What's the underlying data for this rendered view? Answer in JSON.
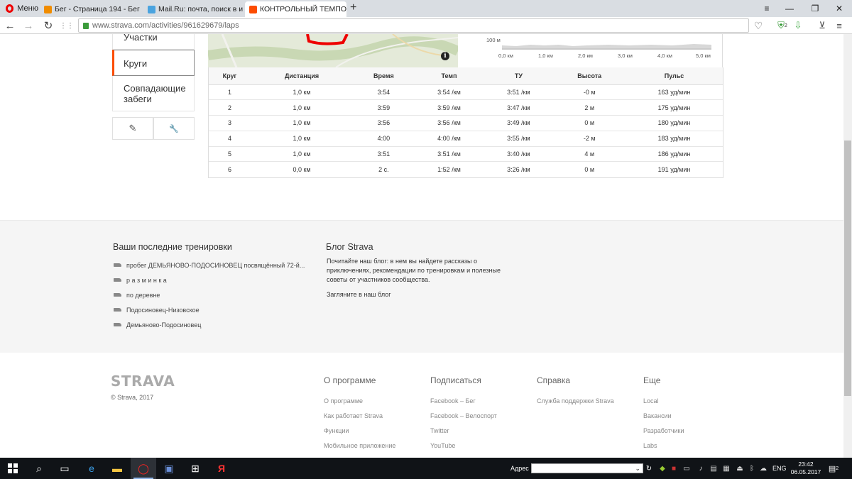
{
  "browser": {
    "menu_label": "Меню",
    "tabs": [
      {
        "title": "Бег - Страница 194 - Бег",
        "favicon_color": "#f08c00"
      },
      {
        "title": "Mail.Ru: почта, поиск в и",
        "favicon_color": "#4aa3df"
      },
      {
        "title": "КОНТРОЛЬНЫЙ ТЕМПОВ",
        "favicon_color": "#fc4c02"
      }
    ],
    "tab_close": "×",
    "new_tab": "+",
    "url": "www.strava.com/activities/961629679/laps",
    "icons": {
      "back": "←",
      "forward": "→",
      "reload": "↻",
      "speed_dial": "⋮⋮",
      "heart": "♡",
      "minimize": "—",
      "maximize": "❐",
      "close": "✕",
      "stash": "≡"
    },
    "ext_badge": "2"
  },
  "sidebar": {
    "items": [
      {
        "label": "Участки",
        "active": false
      },
      {
        "label": "Круги",
        "active": true
      },
      {
        "label": "Совпадающие забеги",
        "active": false
      }
    ],
    "tool_icons": {
      "edit": "✎",
      "settings": "🔧"
    }
  },
  "map": {
    "info_label": "i"
  },
  "elevation": {
    "y_label": "100 м",
    "x_labels": [
      "0,0 км",
      "1,0 км",
      "2,0 км",
      "3,0 км",
      "4,0 км",
      "5,0 км"
    ]
  },
  "laps": {
    "headers": [
      "Круг",
      "Дистанция",
      "Время",
      "Темп",
      "ТУ",
      "Высота",
      "Пульс"
    ],
    "rows": [
      [
        "1",
        "1,0 км",
        "3:54",
        "3:54 /км",
        "3:51 /км",
        "-0 м",
        "163 уд/мин"
      ],
      [
        "2",
        "1,0 км",
        "3:59",
        "3:59 /км",
        "3:47 /км",
        "2 м",
        "175 уд/мин"
      ],
      [
        "3",
        "1,0 км",
        "3:56",
        "3:56 /км",
        "3:49 /км",
        "0 м",
        "180 уд/мин"
      ],
      [
        "4",
        "1,0 км",
        "4:00",
        "4:00 /км",
        "3:55 /км",
        "-2 м",
        "183 уд/мин"
      ],
      [
        "5",
        "1,0 км",
        "3:51",
        "3:51 /км",
        "3:40 /км",
        "4 м",
        "186 уд/мин"
      ],
      [
        "6",
        "0,0 км",
        "2 с.",
        "1:52 /км",
        "3:26 /км",
        "0 м",
        "191 уд/мин"
      ]
    ]
  },
  "recent": {
    "title": "Ваши последние тренировки",
    "items": [
      "пробег ДЕМЬЯНОВО-ПОДОСИНОВЕЦ посвящённый 72-й...",
      "р а з м и н к а",
      "по деревне",
      "Подосиновец-Низовское",
      "Демьяново-Подосиновец"
    ]
  },
  "blog": {
    "title": "Блог Strava",
    "text": "Почитайте наш блог: в нем вы найдете рассказы о приключениях, рекомендации по тренировкам и полезные советы от участников сообщества.",
    "link": "Загляните в наш блог"
  },
  "footer": {
    "logo": "STRAVA",
    "copyright": "© Strava, 2017",
    "columns": [
      {
        "title": "О программе",
        "links": [
          "О программе",
          "Как работает Strava",
          "Функции",
          "Мобильное приложение"
        ]
      },
      {
        "title": "Подписаться",
        "links": [
          "Facebook – Бег",
          "Facebook – Велоспорт",
          "Twitter",
          "YouTube"
        ]
      },
      {
        "title": "Справка",
        "links": [
          "Служба поддержки Strava"
        ]
      },
      {
        "title": "Еще",
        "links": [
          "Local",
          "Вакансии",
          "Разработчики",
          "Labs"
        ]
      }
    ]
  },
  "taskbar": {
    "address_label": "Адрес",
    "address_value": "",
    "lang": "ENG",
    "time": "23:42",
    "date": "06.05.2017",
    "notif_count": "2"
  }
}
